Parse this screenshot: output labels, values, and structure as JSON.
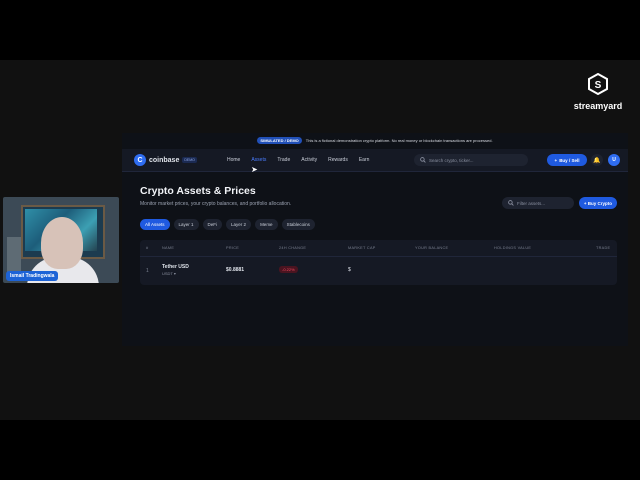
{
  "stream": {
    "brand": "streamyard",
    "presenter": "Ismail Tradingwala"
  },
  "banner": {
    "badge": "SIMULATED / DEMO",
    "text": "This is a fictional demonstration crypto platform. No real money or blockchain transactions are processed."
  },
  "nav": {
    "logo_letter": "C",
    "brand": "coinbase",
    "brand_badge": "DEMO",
    "items": [
      {
        "label": "Home",
        "active": false
      },
      {
        "label": "Assets",
        "active": true
      },
      {
        "label": "Trade",
        "active": false
      },
      {
        "label": "Activity",
        "active": false
      },
      {
        "label": "Rewards",
        "active": false
      },
      {
        "label": "Earn",
        "active": false
      }
    ],
    "search_placeholder": "Search crypto, ticker...",
    "buy_sell": "Buy / Sell",
    "avatar": "U"
  },
  "page": {
    "title": "Crypto Assets & Prices",
    "subtitle": "Monitor market prices, your crypto balances, and portfolio allocation.",
    "filter_placeholder": "Filter assets...",
    "buy_crypto": "+ Buy Crypto",
    "chips": [
      "All Assets",
      "Layer 1",
      "DeFi",
      "Layer 2",
      "Meme",
      "Stablecoins"
    ],
    "active_chip": "All Assets"
  },
  "table": {
    "headers": [
      "#",
      "NAME",
      "PRICE",
      "24H CHANGE",
      "MARKET CAP",
      "YOUR BALANCE",
      "HOLDINGS VALUE",
      "TRADE"
    ],
    "rows": [
      {
        "rank": "1",
        "name": "Tether USD",
        "ticker": "USDT ▾",
        "price": "$0.8881",
        "change": "-0.22%",
        "market_cap": "$",
        "balance": "",
        "holdings": "",
        "trade": ""
      }
    ]
  },
  "colors": {
    "accent": "#1f5ae0",
    "negative": "#f2495f",
    "background": "#0e1117"
  }
}
